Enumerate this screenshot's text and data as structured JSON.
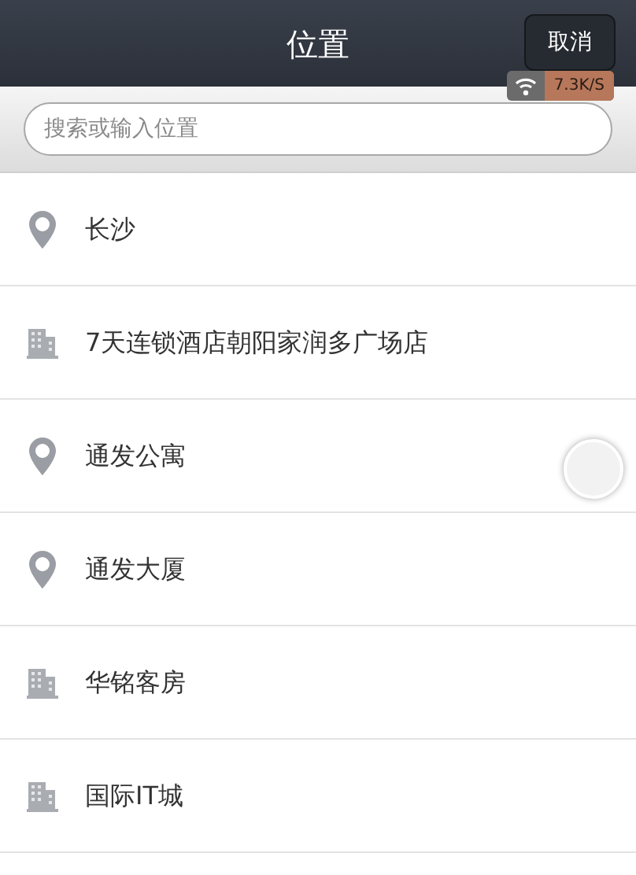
{
  "header": {
    "title": "位置",
    "cancel_button": "取消"
  },
  "status_overlay": {
    "speed": "7.3K/S"
  },
  "search": {
    "placeholder": "搜索或输入位置"
  },
  "places": [
    {
      "kind": "pin",
      "name": "长沙"
    },
    {
      "kind": "building",
      "name": "7天连锁酒店朝阳家润多广场店"
    },
    {
      "kind": "pin",
      "name": "通发公寓"
    },
    {
      "kind": "pin",
      "name": "通发大厦"
    },
    {
      "kind": "building",
      "name": "华铭客房"
    },
    {
      "kind": "building",
      "name": "国际IT城"
    }
  ]
}
